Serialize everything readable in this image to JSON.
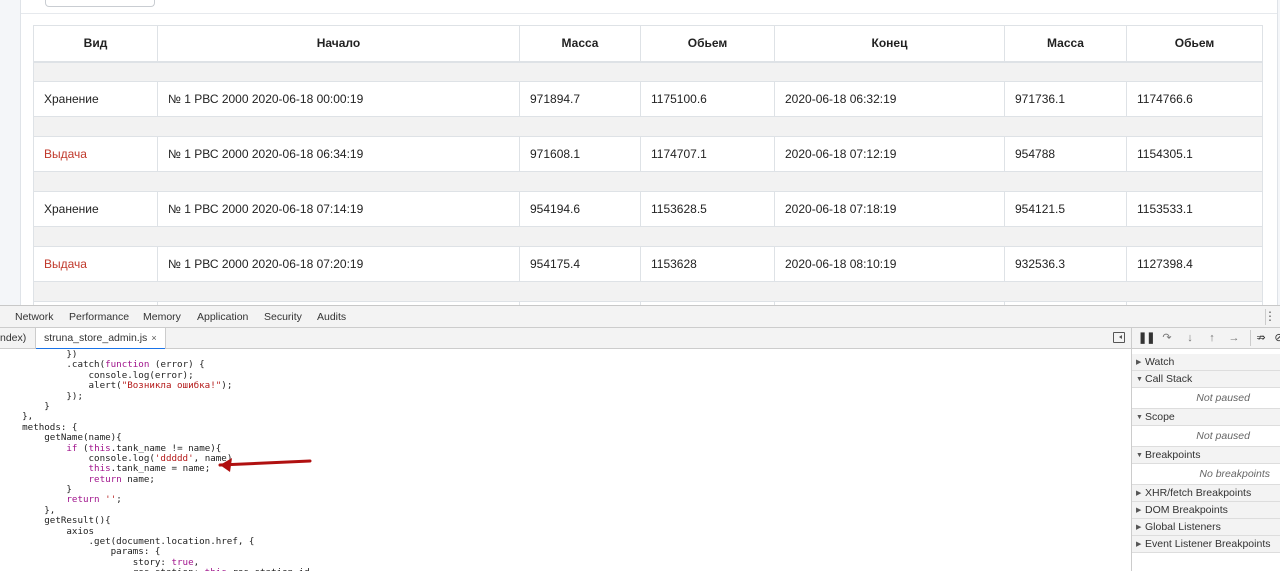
{
  "table": {
    "headers": [
      "Вид",
      "Начало",
      "Масса",
      "Обьем",
      "Конец",
      "Масса",
      "Обьем"
    ],
    "rows": [
      {
        "kind": "Хранение",
        "start": "№ 1 РВС 2000 2020-06-18 00:00:19",
        "mass1": "971894.7",
        "vol1": "1175100.6",
        "end": "2020-06-18 06:32:19",
        "mass2": "971736.1",
        "vol2": "1174766.6"
      },
      {
        "kind": "Выдача",
        "start": "№ 1 РВС 2000 2020-06-18 06:34:19",
        "mass1": "971608.1",
        "vol1": "1174707.1",
        "end": "2020-06-18 07:12:19",
        "mass2": "954788",
        "vol2": "1154305.1"
      },
      {
        "kind": "Хранение",
        "start": "№ 1 РВС 2000 2020-06-18 07:14:19",
        "mass1": "954194.6",
        "vol1": "1153628.5",
        "end": "2020-06-18 07:18:19",
        "mass2": "954121.5",
        "vol2": "1153533.1"
      },
      {
        "kind": "Выдача",
        "start": "№ 1 РВС 2000 2020-06-18 07:20:19",
        "mass1": "954175.4",
        "vol1": "1153628",
        "end": "2020-06-18 08:10:19",
        "mass2": "932536.3",
        "vol2": "1127398.4"
      }
    ]
  },
  "devtools": {
    "tabs": [
      "Network",
      "Performance",
      "Memory",
      "Application",
      "Security",
      "Audits"
    ],
    "source_tabs": {
      "index_partial": "ndex)",
      "file": "struna_store_admin.js",
      "close": "×"
    },
    "code_lines": [
      "            })",
      "            .catch(function (error) {",
      "                console.log(error);",
      "                alert(\"Возникла ошибка!\");",
      "            });",
      "        }",
      "    },",
      "    methods: {",
      "        getName(name){",
      "            if (this.tank_name != name){",
      "                console.log('ddddd', name)",
      "                this.tank_name = name;",
      "                return name;",
      "            }",
      "            return '';",
      "        },",
      "        getResult(){",
      "            axios",
      "                .get(document.location.href, {",
      "                    params: {",
      "                        story: true,",
      "                        res_station: this.res_station_id"
    ],
    "debugger": {
      "sections": [
        {
          "title": "Watch",
          "empty": ""
        },
        {
          "title": "Call Stack",
          "empty": "Not paused"
        },
        {
          "title": "Scope",
          "empty": "Not paused"
        },
        {
          "title": "Breakpoints",
          "empty": "No breakpoints"
        },
        {
          "title": "XHR/fetch Breakpoints",
          "empty": ""
        },
        {
          "title": "DOM Breakpoints",
          "empty": ""
        },
        {
          "title": "Global Listeners",
          "empty": ""
        },
        {
          "title": "Event Listener Breakpoints",
          "empty": ""
        }
      ]
    },
    "colors": {
      "annotation_arrow": "#b01010",
      "vydacha": "#c0392b"
    }
  }
}
